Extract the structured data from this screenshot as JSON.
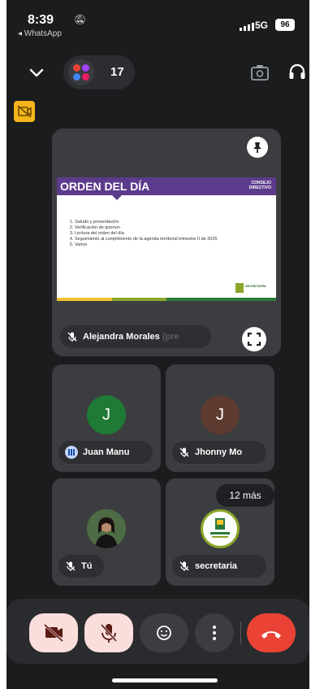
{
  "status_bar": {
    "time": "8:39",
    "back_app": "◂ WhatsApp",
    "network": "5G",
    "battery": "96"
  },
  "header": {
    "participant_count": "17"
  },
  "presentation": {
    "slide_title": "ORDEN DEL DÍA",
    "slide_tag_line1": "CONSEJO",
    "slide_tag_line2": "DIRECTIVO",
    "agenda_items": [
      "Saludo y presentación",
      "Verificación de quorum",
      "Lectura del orden del día",
      "Seguimiento al cumplimiento de la agenda territorial trimestre II de 2025",
      "Varios"
    ],
    "logo_text": "SECRETARÍA",
    "presenter_name": "Alejandra Morales",
    "presenter_name_fade": "(pre"
  },
  "participants": [
    {
      "initial": "J",
      "name": "Juan Manu",
      "avatar_color": "#1e7a34"
    },
    {
      "initial": "J",
      "name": "Jhonny Mo",
      "avatar_color": "#5d3b30"
    },
    {
      "initial": "",
      "name": "Tú",
      "avatar_color": "#3c5a3a"
    },
    {
      "initial": "",
      "name": "secretaria",
      "avatar_color": "#ffffff"
    }
  ],
  "more_participants": "12 más",
  "colors": {
    "background": "#1b1c1e",
    "tile": "#3c3d40",
    "end_call": "#ea4335",
    "muted_button": "#f9dedc",
    "slide_purple": "#5c3b8c"
  }
}
